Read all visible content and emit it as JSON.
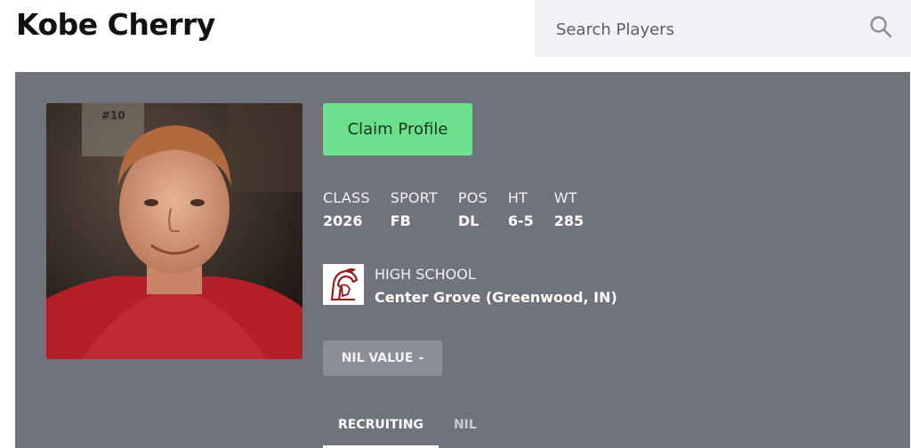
{
  "header": {
    "player_name": "Kobe Cherry",
    "search": {
      "placeholder": "Search Players",
      "icon": "search-icon"
    }
  },
  "profile": {
    "claim_label": "Claim Profile",
    "stats": [
      {
        "label": "CLASS",
        "value": "2026"
      },
      {
        "label": "SPORT",
        "value": "FB"
      },
      {
        "label": "POS",
        "value": "DL"
      },
      {
        "label": "HT",
        "value": "6-5"
      },
      {
        "label": "WT",
        "value": "285"
      }
    ],
    "school": {
      "label": "HIGH SCHOOL",
      "name": "Center Grove (Greenwood, IN)",
      "logo_icon": "trojan-helmet-icon"
    },
    "nil": {
      "label": "NIL VALUE",
      "value": "-"
    },
    "tabs": [
      {
        "label": "RECRUITING",
        "active": true
      },
      {
        "label": "NIL",
        "active": false
      }
    ]
  },
  "colors": {
    "card_bg": "#70737b",
    "claim_button": "#6ce08c",
    "nil_button": "#8b8e95",
    "search_bg": "#f1f2f6",
    "logo_red": "#9b1c1f"
  }
}
